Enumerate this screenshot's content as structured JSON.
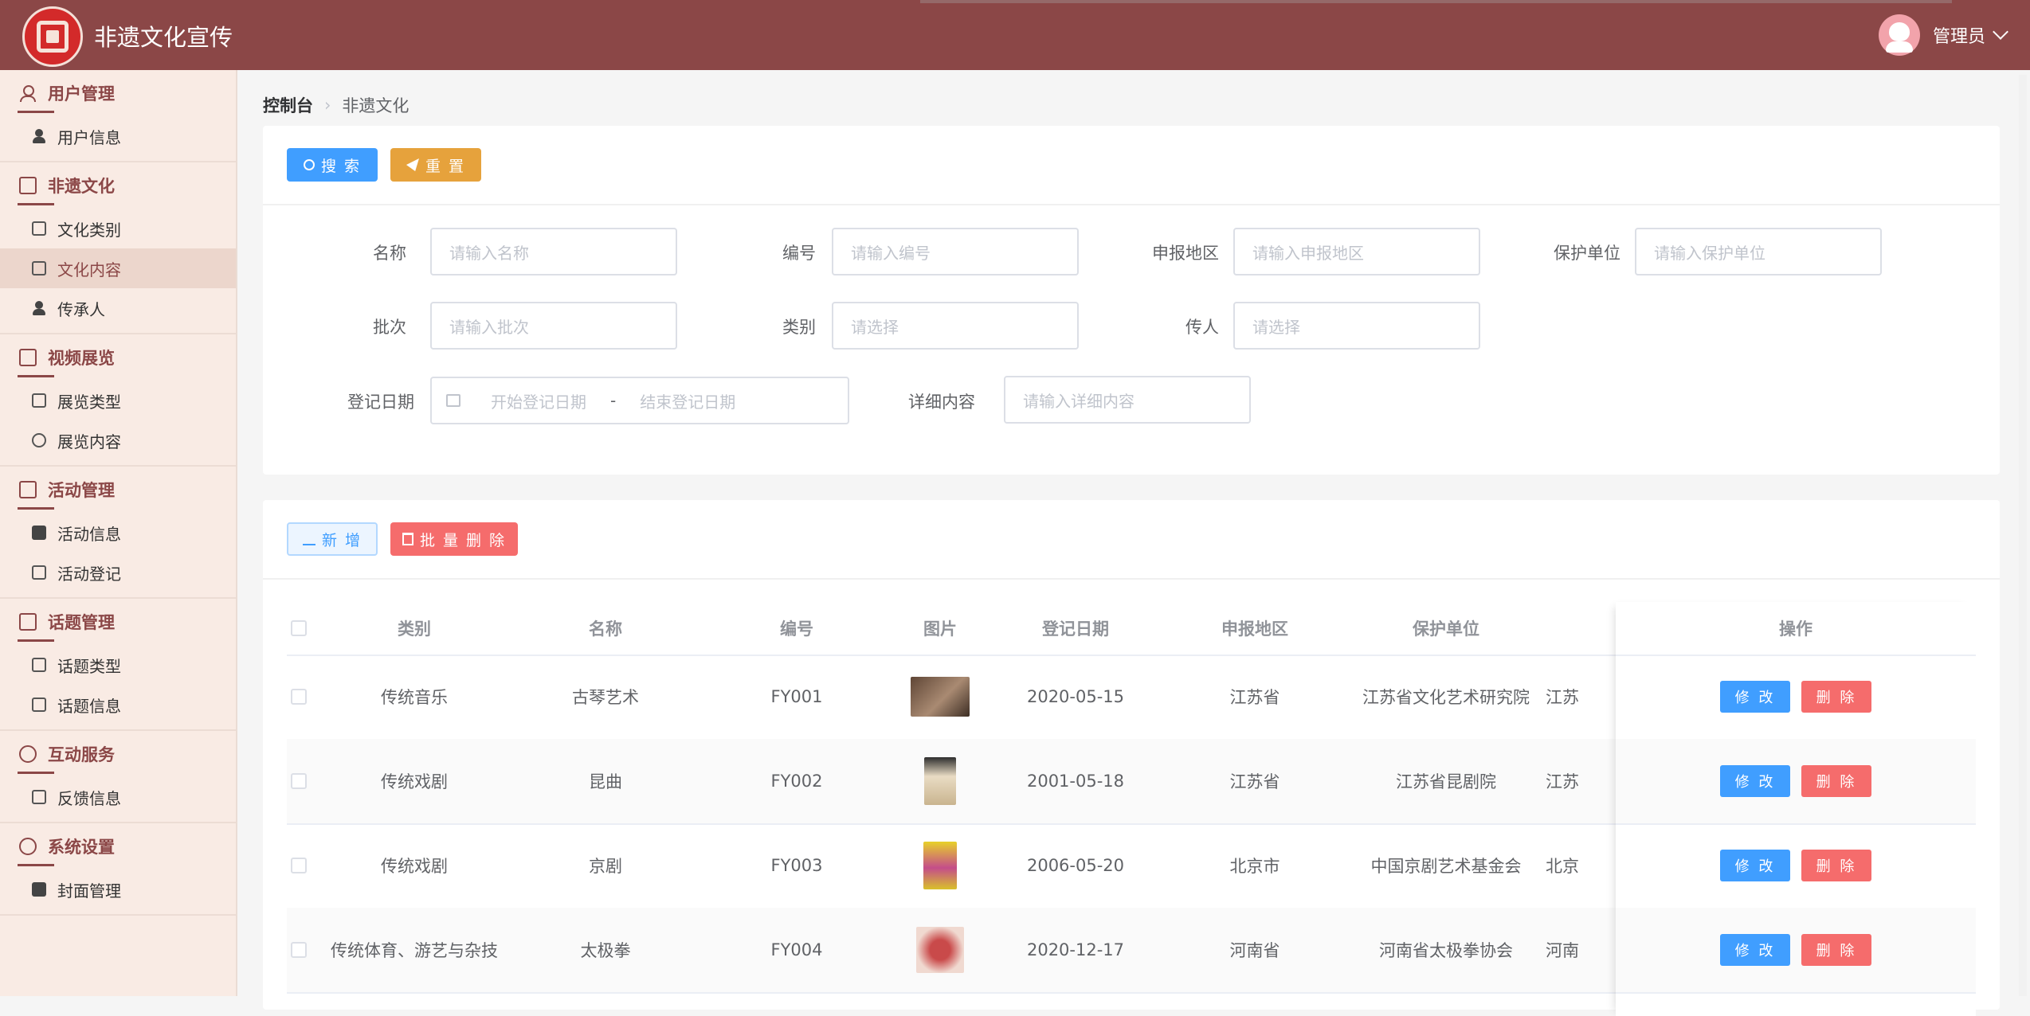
{
  "header": {
    "app_title": "非遗文化宣传",
    "user_name": "管理员"
  },
  "sidebar": {
    "groups": [
      {
        "title": "用户管理",
        "items": [
          {
            "label": "用户信息"
          }
        ]
      },
      {
        "title": "非遗文化",
        "items": [
          {
            "label": "文化类别"
          },
          {
            "label": "文化内容",
            "active": true
          },
          {
            "label": "传承人"
          }
        ]
      },
      {
        "title": "视频展览",
        "items": [
          {
            "label": "展览类型"
          },
          {
            "label": "展览内容"
          }
        ]
      },
      {
        "title": "活动管理",
        "items": [
          {
            "label": "活动信息"
          },
          {
            "label": "活动登记"
          }
        ]
      },
      {
        "title": "话题管理",
        "items": [
          {
            "label": "话题类型"
          },
          {
            "label": "话题信息"
          }
        ]
      },
      {
        "title": "互动服务",
        "items": [
          {
            "label": "反馈信息"
          }
        ]
      },
      {
        "title": "系统设置",
        "items": [
          {
            "label": "封面管理"
          }
        ]
      }
    ]
  },
  "breadcrumb": {
    "home": "控制台",
    "current": "非遗文化"
  },
  "search_toolbar": {
    "search": "搜 索",
    "reset": "重 置"
  },
  "form": {
    "name": {
      "label": "名称",
      "placeholder": "请输入名称"
    },
    "code": {
      "label": "编号",
      "placeholder": "请输入编号"
    },
    "region": {
      "label": "申报地区",
      "placeholder": "请输入申报地区"
    },
    "unit": {
      "label": "保护单位",
      "placeholder": "请输入保护单位"
    },
    "batch": {
      "label": "批次",
      "placeholder": "请输入批次"
    },
    "category": {
      "label": "类别",
      "placeholder": "请选择"
    },
    "inheritor": {
      "label": "传人",
      "placeholder": "请选择"
    },
    "date": {
      "label": "登记日期",
      "start_placeholder": "开始登记日期",
      "separator": "-",
      "end_placeholder": "结束登记日期"
    },
    "detail": {
      "label": "详细内容",
      "placeholder": "请输入详细内容"
    }
  },
  "table_toolbar": {
    "add": "新 增",
    "batch_delete": "批 量 删 除"
  },
  "table": {
    "columns": {
      "category": "类别",
      "name": "名称",
      "code": "编号",
      "image": "图片",
      "date": "登记日期",
      "region": "申报地区",
      "unit": "保护单位",
      "ops": "操作"
    },
    "rows": [
      {
        "category": "传统音乐",
        "name": "古琴艺术",
        "code": "FY001",
        "date": "2020-05-15",
        "region": "江苏省",
        "unit": "江苏省文化艺术研究院",
        "partial": "江苏",
        "thumb_color": "#7a5b45"
      },
      {
        "category": "传统戏剧",
        "name": "昆曲",
        "code": "FY002",
        "date": "2001-05-18",
        "region": "江苏省",
        "unit": "江苏省昆剧院",
        "partial": "江苏",
        "thumb_color": "#c9b48f"
      },
      {
        "category": "传统戏剧",
        "name": "京剧",
        "code": "FY003",
        "date": "2006-05-20",
        "region": "北京市",
        "unit": "中国京剧艺术基金会",
        "partial": "北京",
        "thumb_color": "#d9c12a"
      },
      {
        "category": "传统体育、游艺与杂技",
        "name": "太极拳",
        "code": "FY004",
        "date": "2020-12-17",
        "region": "河南省",
        "unit": "河南省太极拳协会",
        "partial": "河南",
        "thumb_color": "#c94a4a"
      }
    ],
    "edit_label": "修 改",
    "delete_label": "删 除"
  },
  "colors": {
    "header": "#8b4747",
    "primary": "#409eff",
    "warning": "#e6a23c",
    "danger": "#f56c6c"
  }
}
